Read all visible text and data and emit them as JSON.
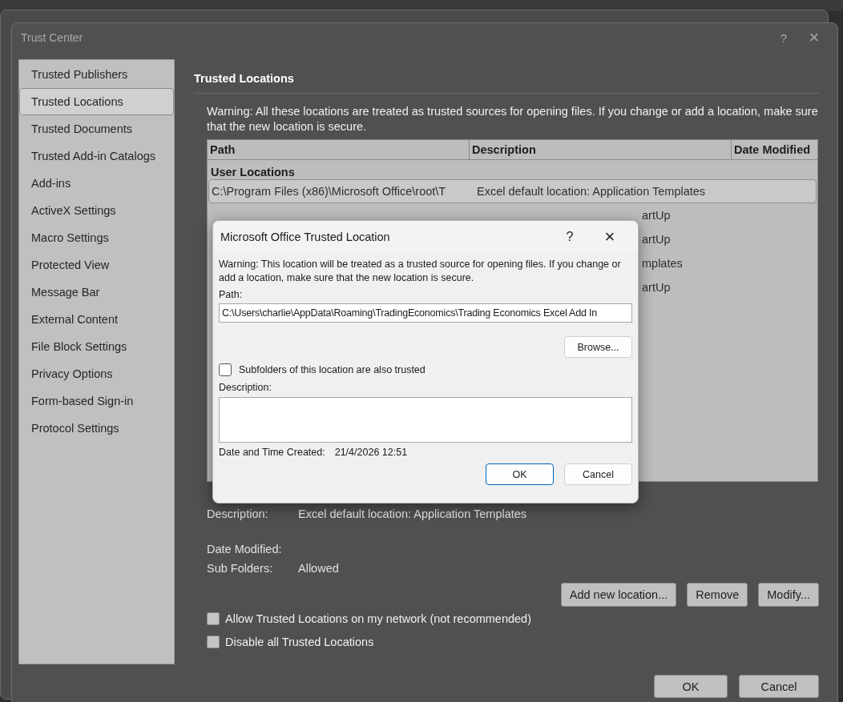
{
  "window": {
    "title": "Trust Center",
    "help": "?",
    "close": "×"
  },
  "sidebar": {
    "items": [
      {
        "label": "Trusted Publishers",
        "selected": false
      },
      {
        "label": "Trusted Locations",
        "selected": true
      },
      {
        "label": "Trusted Documents",
        "selected": false
      },
      {
        "label": "Trusted Add-in Catalogs",
        "selected": false
      },
      {
        "label": "Add-ins",
        "selected": false
      },
      {
        "label": "ActiveX Settings",
        "selected": false
      },
      {
        "label": "Macro Settings",
        "selected": false
      },
      {
        "label": "Protected View",
        "selected": false
      },
      {
        "label": "Message Bar",
        "selected": false
      },
      {
        "label": "External Content",
        "selected": false
      },
      {
        "label": "File Block Settings",
        "selected": false
      },
      {
        "label": "Privacy Options",
        "selected": false
      },
      {
        "label": "Form-based Sign-in",
        "selected": false
      },
      {
        "label": "Protocol Settings",
        "selected": false
      }
    ]
  },
  "section_title": "Trusted Locations",
  "warning": "Warning: All these locations are treated as trusted sources for opening files.  If you change or add a location, make sure that the new location is secure.",
  "table": {
    "columns": [
      "Path",
      "Description",
      "Date Modified"
    ],
    "group": "User Locations",
    "rows": [
      {
        "path": "C:\\Program Files (x86)\\Microsoft Office\\root\\T",
        "description": "Excel default location: Application Templates",
        "selected": true
      },
      {
        "path": "",
        "description": "artUp",
        "selected": false
      },
      {
        "path": "",
        "description": "artUp",
        "selected": false
      },
      {
        "path": "",
        "description": "mplates",
        "selected": false
      },
      {
        "path": "",
        "description": "artUp",
        "selected": false
      }
    ]
  },
  "details": [
    {
      "label": "Description:",
      "value": "Excel default location: Application Templates"
    },
    {
      "label": "Date Modified:"
    },
    {
      "label": "Sub Folders:",
      "value": "Allowed"
    }
  ],
  "actions": [
    "Add new location...",
    "Remove",
    "Modify..."
  ],
  "options": [
    {
      "label": "Allow Trusted Locations on my network (not recommended)",
      "checked": false
    },
    {
      "label": "Disable all Trusted Locations",
      "checked": false
    }
  ],
  "buttons": [
    "OK",
    "Cancel"
  ],
  "dialog": {
    "title": "Microsoft Office Trusted Location",
    "help": "?",
    "close": "×",
    "warning": "Warning: This location will be treated as a trusted source for opening files. If you change or add a location, make sure that the new location is secure.",
    "path_label": "Path:",
    "path_value": "C:\\Users\\charlie\\AppData\\Roaming\\TradingEconomics\\Trading Economics Excel Add In",
    "browse": "Browse...",
    "subfolders": {
      "label": "Subfolders of this location are also trusted",
      "checked": false
    },
    "description_label": "Description:",
    "created_label": "Date and Time Created:",
    "created_value": "21/4/2026 12:51",
    "buttons": [
      "OK",
      "Cancel"
    ]
  }
}
